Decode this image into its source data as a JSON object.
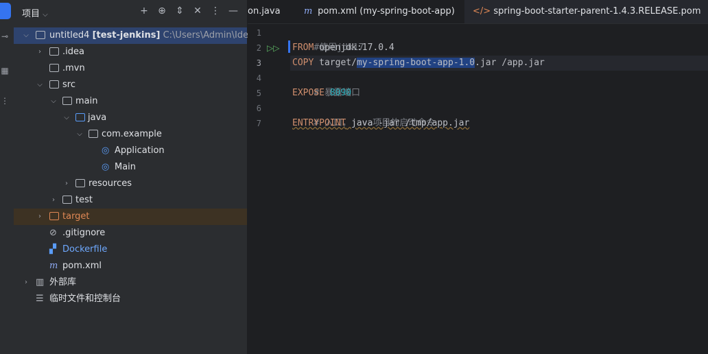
{
  "project_panel": {
    "title": "项目",
    "tools": [
      "add-icon",
      "locate-icon",
      "expand-icon",
      "collapse-icon",
      "more-icon",
      "minimize-icon"
    ],
    "tree": [
      {
        "label": "untitled4",
        "bold": "[test-jenkins]",
        "path": "C:\\Users\\Admin\\IdeaProj"
      },
      {
        "label": ".idea"
      },
      {
        "label": ".mvn"
      },
      {
        "label": "src"
      },
      {
        "label": "main"
      },
      {
        "label": "java"
      },
      {
        "label": "com.example"
      },
      {
        "label": "Application"
      },
      {
        "label": "Main"
      },
      {
        "label": "resources"
      },
      {
        "label": "test"
      },
      {
        "label": "target"
      },
      {
        "label": ".gitignore"
      },
      {
        "label": "Dockerfile"
      },
      {
        "label": "pom.xml"
      },
      {
        "label": "外部库"
      },
      {
        "label": "临时文件和控制台"
      }
    ]
  },
  "tabs": [
    {
      "label": "on.java"
    },
    {
      "label": "pom.xml (my-spring-boot-app)"
    },
    {
      "label": "spring-boot-starter-parent-1.4.3.RELEASE.pom"
    }
  ],
  "editor": {
    "line_numbers": [
      "1",
      "2",
      "3",
      "4",
      "5",
      "6",
      "7"
    ],
    "lines": [
      {
        "text": "#使用jdk17"
      },
      {
        "kw": "FROM",
        "rest": " openjdk:17.0.4"
      },
      {
        "kw": "COPY",
        "pre": " target/",
        "sel": "my-spring-boot-app-1.0",
        "post": ".jar /app.jar"
      },
      {
        "text": "# 暴露端口"
      },
      {
        "kw": "EXPOSE",
        "num": " 8090"
      },
      {
        "text": "# 入口，java项目的启动命令"
      },
      {
        "kw": "ENTRYPOINT",
        "rest": " java -jar /tmp/app.jar"
      }
    ]
  },
  "colors": {
    "accent": "#3574f0",
    "keyword": "#cf8e6d",
    "number": "#2aacb8",
    "comment": "#7a7e85"
  }
}
